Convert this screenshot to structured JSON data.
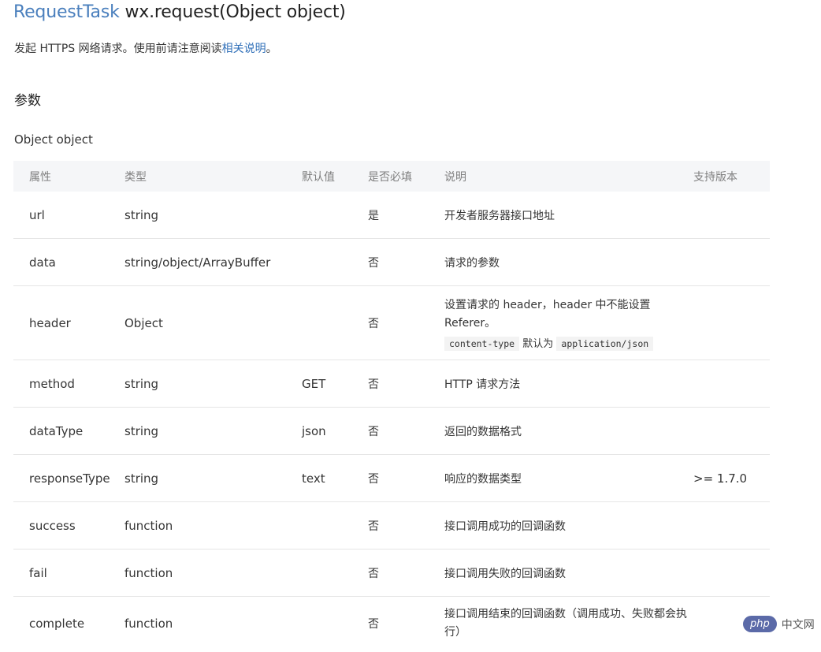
{
  "title": {
    "link": "RequestTask",
    "rest": "wx.request(Object object)"
  },
  "description": {
    "text": "发起 HTTPS 网络请求。使用前请注意阅读",
    "link": "相关说明",
    "suffix": "。"
  },
  "params_heading": "参数",
  "object_label": "Object object",
  "table": {
    "headers": [
      "属性",
      "类型",
      "默认值",
      "是否必填",
      "说明",
      "支持版本"
    ],
    "rows": [
      {
        "name": "url",
        "type": "string",
        "default": "",
        "required": "是",
        "desc": "开发者服务器接口地址",
        "version": ""
      },
      {
        "name": "data",
        "type": "string/object/ArrayBuffer",
        "default": "",
        "required": "否",
        "desc": "请求的参数",
        "version": ""
      },
      {
        "name": "header",
        "type": "Object",
        "default": "",
        "required": "否",
        "desc": "设置请求的 header，header 中不能设置 Referer。",
        "code1": "content-type",
        "mid": "默认为",
        "code2": "application/json",
        "version": ""
      },
      {
        "name": "method",
        "type": "string",
        "default": "GET",
        "required": "否",
        "desc": "HTTP 请求方法",
        "version": ""
      },
      {
        "name": "dataType",
        "type": "string",
        "default": "json",
        "required": "否",
        "desc": "返回的数据格式",
        "version": ""
      },
      {
        "name": "responseType",
        "type": "string",
        "default": "text",
        "required": "否",
        "desc": "响应的数据类型",
        "version": ">= 1.7.0"
      },
      {
        "name": "success",
        "type": "function",
        "default": "",
        "required": "否",
        "desc": "接口调用成功的回调函数",
        "version": ""
      },
      {
        "name": "fail",
        "type": "function",
        "default": "",
        "required": "否",
        "desc": "接口调用失败的回调函数",
        "version": ""
      },
      {
        "name": "complete",
        "type": "function",
        "default": "",
        "required": "否",
        "desc": "接口调用结束的回调函数（调用成功、失败都会执行）",
        "version": ""
      }
    ]
  },
  "watermark": {
    "badge": "php",
    "text": "中文网"
  }
}
